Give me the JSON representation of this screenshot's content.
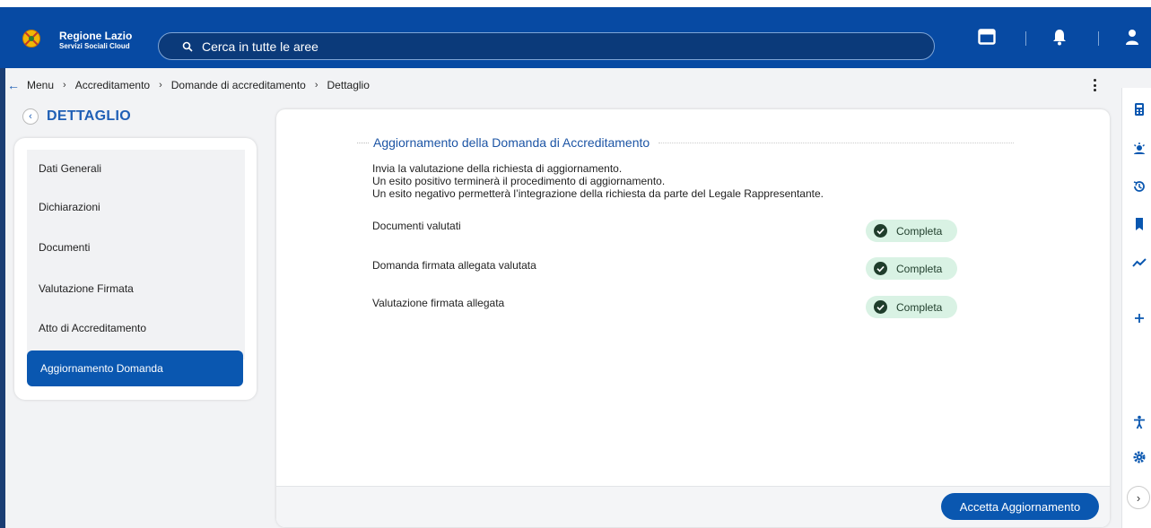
{
  "header": {
    "brand_title": "Regione Lazio",
    "brand_subtitle": "Servizi Sociali Cloud",
    "search_placeholder": "Cerca in tutte le aree",
    "colors": {
      "bar": "#074aa3",
      "accent": "#0a57b0"
    }
  },
  "breadcrumb": {
    "items": [
      "Menu",
      "Accreditamento",
      "Domande di accreditamento",
      "Dettaglio"
    ]
  },
  "sidebar": {
    "title": "DETTAGLIO",
    "items": [
      {
        "label": "Dati Generali",
        "active": false
      },
      {
        "label": "Dichiarazioni",
        "active": false
      },
      {
        "label": "Documenti",
        "active": false
      },
      {
        "label": "Valutazione Firmata",
        "active": false
      },
      {
        "label": "Atto di Accreditamento",
        "active": false
      },
      {
        "label": "Aggiornamento Domanda",
        "active": true
      }
    ]
  },
  "main": {
    "title": "Aggiornamento della Domanda di Accreditamento",
    "intro": [
      "Invia la valutazione della richiesta di aggiornamento.",
      "Un esito positivo terminerà il procedimento di aggiornamento.",
      "Un esito negativo permetterà l’integrazione della richiesta da parte del Legale Rappresentante."
    ],
    "rows": [
      {
        "label": "Documenti valutati",
        "status": "Completa"
      },
      {
        "label": "Domanda firmata allegata valutata",
        "status": "Completa"
      },
      {
        "label": "Valutazione firmata allegata",
        "status": "Completa"
      }
    ],
    "accept_button": "Accetta Aggiornamento"
  },
  "rail_icons": [
    "calculator-icon",
    "weather-icon",
    "history-icon",
    "bookmark-icon",
    "trend-icon",
    "plus-icon",
    "accessibility-icon",
    "settings-icon",
    "chevron-right-icon"
  ]
}
